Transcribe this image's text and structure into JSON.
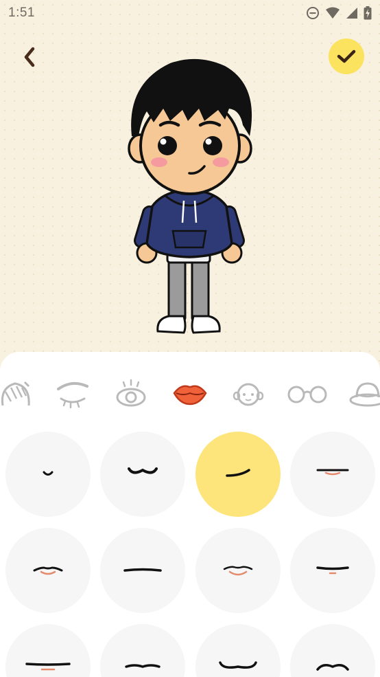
{
  "status_bar": {
    "time": "1:51",
    "icons": [
      "do-not-disturb-icon",
      "wifi-icon",
      "signal-icon",
      "battery-charging-icon"
    ]
  },
  "header": {
    "back_icon": "chevron-left-icon",
    "confirm_icon": "checkmark-icon"
  },
  "colors": {
    "background": "#f8f1df",
    "accent_yellow": "#fbe35f",
    "selected_option": "#fde57b",
    "option_bg": "#f6f6f6",
    "active_tab_lips": "#f0633a"
  },
  "categories": [
    {
      "icon": "hair-icon",
      "active": false
    },
    {
      "icon": "eyebrow-icon",
      "active": false
    },
    {
      "icon": "eye-icon",
      "active": false
    },
    {
      "icon": "lips-icon",
      "active": true
    },
    {
      "icon": "face-icon",
      "active": false
    },
    {
      "icon": "glasses-icon",
      "active": false
    },
    {
      "icon": "hat-icon",
      "active": false
    }
  ],
  "mouth_options": {
    "selected_index": 2,
    "count_visible": 12
  }
}
